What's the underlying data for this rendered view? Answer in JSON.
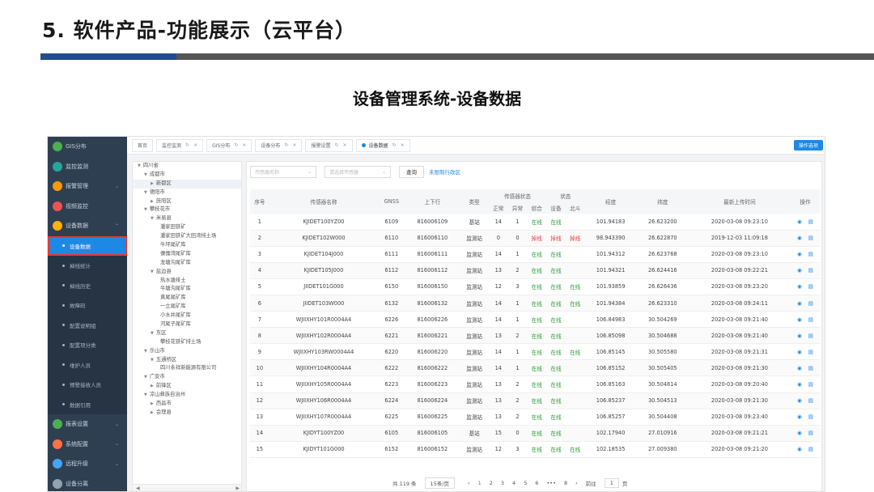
{
  "slide": {
    "title": "5. 软件产品-功能展示（云平台）",
    "subtitle": "设备管理系统-设备数据"
  },
  "sidebar": {
    "items": [
      {
        "label": "GIS分布",
        "color": "#4caf50"
      },
      {
        "label": "监控监测",
        "color": "#26a69a"
      },
      {
        "label": "报警管理",
        "color": "#ff9800"
      },
      {
        "label": "视频监控",
        "color": "#ef5350"
      },
      {
        "label": "设备数据",
        "color": "#ffb300"
      }
    ],
    "sub_items": [
      "设备数据",
      "掉线统计",
      "掉线历史",
      "故障码",
      "配置说明组",
      "配置项分类",
      "维护人员",
      "预警接收人员",
      "数据引用"
    ],
    "bottom_items": [
      {
        "label": "报表设置",
        "color": "#4caf50"
      },
      {
        "label": "系统配置",
        "color": "#ff7043"
      },
      {
        "label": "远程升级",
        "color": "#42a5f5"
      },
      {
        "label": "设备分离",
        "color": "#90a4ae"
      }
    ]
  },
  "tabs": {
    "items": [
      "首页",
      "监控监测",
      "GIS分布",
      "设备分布",
      "报警设置",
      "设备数据"
    ],
    "active": "设备数据",
    "button": "操作选项"
  },
  "tree": {
    "nodes": [
      {
        "label": "四川省",
        "level": 0,
        "open": true
      },
      {
        "label": "成都市",
        "level": 1,
        "open": true
      },
      {
        "label": "新都区",
        "level": 2,
        "open": false,
        "selected": true
      },
      {
        "label": "德阳市",
        "level": 1,
        "open": true
      },
      {
        "label": "旌阳区",
        "level": 2,
        "open": false
      },
      {
        "label": "攀枝花市",
        "level": 1,
        "open": true
      },
      {
        "label": "米易县",
        "level": 2,
        "open": true
      },
      {
        "label": "潘家田铁矿",
        "level": 3
      },
      {
        "label": "潘家田铁矿大田湾排土场",
        "level": 3
      },
      {
        "label": "牛坪尾矿库",
        "level": 3
      },
      {
        "label": "傈僳湾尾矿库",
        "level": 3
      },
      {
        "label": "龙塘沟尾矿库",
        "level": 3
      },
      {
        "label": "盐边县",
        "level": 2,
        "open": true
      },
      {
        "label": "热水塘排土",
        "level": 3
      },
      {
        "label": "牛塘沟尾矿库",
        "level": 3
      },
      {
        "label": "黄尾尾矿库",
        "level": 3
      },
      {
        "label": "一立尾矿库",
        "level": 3
      },
      {
        "label": "小水井尾矿库",
        "level": 3
      },
      {
        "label": "河尾子尾矿库",
        "level": 3
      },
      {
        "label": "东区",
        "level": 2,
        "open": true
      },
      {
        "label": "攀枝花铁矿排土场",
        "level": 3
      },
      {
        "label": "乐山市",
        "level": 1,
        "open": true
      },
      {
        "label": "五通桥区",
        "level": 2,
        "open": true
      },
      {
        "label": "四川永祥新能源有限公司",
        "level": 3
      },
      {
        "label": "广安市",
        "level": 1,
        "open": true
      },
      {
        "label": "前锋区",
        "level": 2,
        "open": false
      },
      {
        "label": "凉山彝族自治州",
        "level": 1,
        "open": true
      },
      {
        "label": "西昌市",
        "level": 2,
        "open": false
      },
      {
        "label": "会理县",
        "level": 2,
        "open": false
      }
    ]
  },
  "filters": {
    "select1": "传感器名称",
    "select2": "请选择传感器",
    "query": "查询",
    "unallocated": "未限制行政区"
  },
  "table": {
    "headers": {
      "idx": "序号",
      "name": "传感器名称",
      "gnss": "GNSS",
      "uplink": "上下行",
      "type": "类型",
      "sensor_status": "传感器状态",
      "normal": "正常",
      "abnormal": "异常",
      "total": "综合",
      "status": "状态",
      "device": "设备",
      "beidou": "北斗",
      "lng": "经度",
      "lat": "纬度",
      "last_upload": "最新上传时间",
      "ops": "操作"
    },
    "rows": [
      {
        "idx": "1",
        "name": "KJIDET100YZ00",
        "gnss": "6109",
        "uplink": "816006109",
        "type": "基站",
        "normal": "14",
        "abnormal": "1",
        "total": "在线",
        "device": "在线",
        "beidou": "",
        "lng": "101.94183",
        "lat": "26.623200",
        "time": "2020-03-08 09:23:10",
        "bad": false
      },
      {
        "idx": "2",
        "name": "KJIDET102W000",
        "gnss": "6110",
        "uplink": "816006110",
        "type": "监测站",
        "normal": "0",
        "abnormal": "0",
        "total": "掉线",
        "device": "掉线",
        "beidou": "掉线",
        "lng": "98.943390",
        "lat": "26.622870",
        "time": "2019-12-03 11:09:18",
        "bad": true
      },
      {
        "idx": "3",
        "name": "KJIDET104J000",
        "gnss": "6111",
        "uplink": "816006111",
        "type": "监测站",
        "normal": "14",
        "abnormal": "1",
        "total": "在线",
        "device": "在线",
        "beidou": "",
        "lng": "101.94312",
        "lat": "26.623768",
        "time": "2020-03-08 09:23:10",
        "bad": false
      },
      {
        "idx": "4",
        "name": "KJIDET105J000",
        "gnss": "6112",
        "uplink": "816006112",
        "type": "监测站",
        "normal": "13",
        "abnormal": "2",
        "total": "在线",
        "device": "在线",
        "beidou": "",
        "lng": "101.94321",
        "lat": "26.624416",
        "time": "2020-03-08 09:22:21",
        "bad": false
      },
      {
        "idx": "5",
        "name": "JIIDET101G000",
        "gnss": "6150",
        "uplink": "816006150",
        "type": "监测站",
        "normal": "12",
        "abnormal": "3",
        "total": "在线",
        "device": "在线",
        "beidou": "在线",
        "lng": "101.93859",
        "lat": "26.626436",
        "time": "2020-03-08 09:23:20",
        "bad": false
      },
      {
        "idx": "6",
        "name": "JIIDET103W000",
        "gnss": "6132",
        "uplink": "816006132",
        "type": "监测站",
        "normal": "14",
        "abnormal": "1",
        "total": "在线",
        "device": "在线",
        "beidou": "在线",
        "lng": "101.94384",
        "lat": "26.623310",
        "time": "2020-03-08 09:24:11",
        "bad": false
      },
      {
        "idx": "7",
        "name": "WJIIXHY101R0004A4",
        "gnss": "6226",
        "uplink": "816006226",
        "type": "监测站",
        "normal": "14",
        "abnormal": "1",
        "total": "在线",
        "device": "在线",
        "beidou": "",
        "lng": "106.84983",
        "lat": "30.504269",
        "time": "2020-03-08 09:21:40",
        "bad": false
      },
      {
        "idx": "8",
        "name": "WJIIXHY102R0004A4",
        "gnss": "6221",
        "uplink": "816006221",
        "type": "监测站",
        "normal": "13",
        "abnormal": "2",
        "total": "在线",
        "device": "在线",
        "beidou": "",
        "lng": "106.85098",
        "lat": "30.504688",
        "time": "2020-03-08 09:21:40",
        "bad": false
      },
      {
        "idx": "9",
        "name": "WJIIXHY103RW0004A4",
        "gnss": "6220",
        "uplink": "816006220",
        "type": "监测站",
        "normal": "14",
        "abnormal": "1",
        "total": "在线",
        "device": "在线",
        "beidou": "在线",
        "lng": "106.85145",
        "lat": "30.505580",
        "time": "2020-03-08 09:21:31",
        "bad": false
      },
      {
        "idx": "10",
        "name": "WJIIXHY104R0004A4",
        "gnss": "6222",
        "uplink": "816006222",
        "type": "监测站",
        "normal": "14",
        "abnormal": "1",
        "total": "在线",
        "device": "在线",
        "beidou": "",
        "lng": "106.85152",
        "lat": "30.505405",
        "time": "2020-03-08 09:21:30",
        "bad": false
      },
      {
        "idx": "11",
        "name": "WJIIXHY105R0004A4",
        "gnss": "6223",
        "uplink": "816006223",
        "type": "监测站",
        "normal": "13",
        "abnormal": "2",
        "total": "在线",
        "device": "在线",
        "beidou": "",
        "lng": "106.85163",
        "lat": "30.504814",
        "time": "2020-03-08 09:20:40",
        "bad": false
      },
      {
        "idx": "12",
        "name": "WJIIXHY106R0004A4",
        "gnss": "6224",
        "uplink": "816006224",
        "type": "监测站",
        "normal": "13",
        "abnormal": "2",
        "total": "在线",
        "device": "在线",
        "beidou": "",
        "lng": "106.85237",
        "lat": "30.504513",
        "time": "2020-03-08 09:21:30",
        "bad": false
      },
      {
        "idx": "13",
        "name": "WJIIXHY107R0004A4",
        "gnss": "6225",
        "uplink": "816006225",
        "type": "监测站",
        "normal": "13",
        "abnormal": "2",
        "total": "在线",
        "device": "在线",
        "beidou": "",
        "lng": "106.85257",
        "lat": "30.504408",
        "time": "2020-03-08 09:23:40",
        "bad": false
      },
      {
        "idx": "14",
        "name": "KJIDYT100YZ00",
        "gnss": "6105",
        "uplink": "816006105",
        "type": "基站",
        "normal": "15",
        "abnormal": "0",
        "total": "在线",
        "device": "在线",
        "beidou": "",
        "lng": "102.17940",
        "lat": "27.010916",
        "time": "2020-03-08 09:21:21",
        "bad": false
      },
      {
        "idx": "15",
        "name": "KJIDYT101G000",
        "gnss": "6152",
        "uplink": "816006152",
        "type": "监测站",
        "normal": "12",
        "abnormal": "3",
        "total": "在线",
        "device": "在线",
        "beidou": "在线",
        "lng": "102.18535",
        "lat": "27.009380",
        "time": "2020-03-08 09:21:20",
        "bad": false
      }
    ]
  },
  "pager": {
    "total": "共 119 条",
    "size": "15条/页",
    "pages": [
      "1",
      "2",
      "3",
      "4",
      "5",
      "6",
      "•••",
      "8"
    ],
    "goto": "前往",
    "goto_value": "1",
    "page_unit": "页"
  }
}
